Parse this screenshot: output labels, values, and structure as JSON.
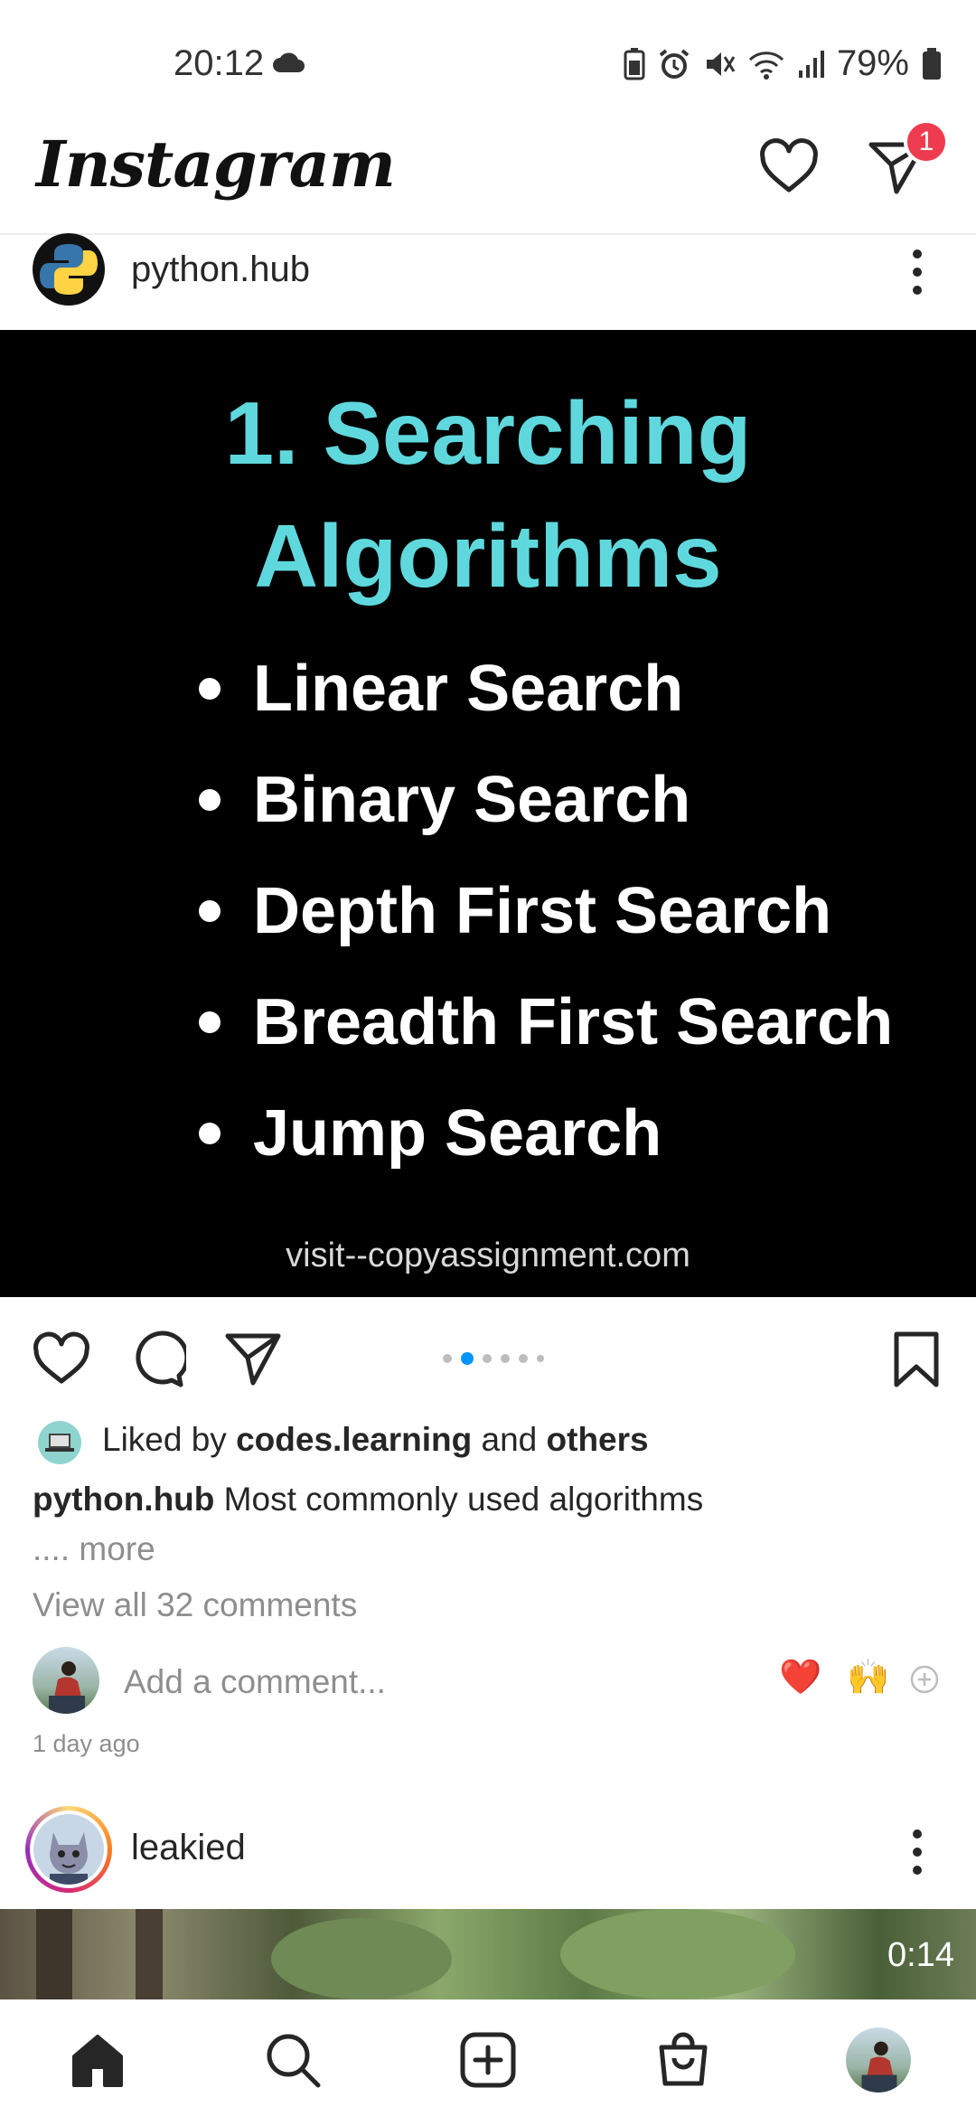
{
  "status_bar": {
    "time": "20:12",
    "battery": "79%"
  },
  "header": {
    "logo": "Instagram",
    "messages_badge": "1"
  },
  "post": {
    "username": "python.hub",
    "image": {
      "title_line1": "1. Searching",
      "title_line2": "Algorithms",
      "items": [
        "Linear Search",
        "Binary Search",
        "Depth First Search",
        "Breadth First Search",
        "Jump Search"
      ],
      "footer": "visit--copyassignment.com"
    },
    "carousel": {
      "count": 6,
      "active": 2
    },
    "liked_by_prefix": "Liked by",
    "liked_by_user": "codes.learning",
    "liked_by_and": "and",
    "liked_by_others": "others",
    "caption_user": "python.hub",
    "caption_text": "Most commonly used algorithms",
    "caption_more": ".... more",
    "view_comments": "View all 32 comments",
    "comment_placeholder": "Add a comment...",
    "quick_emoji_1": "❤️",
    "quick_emoji_2": "🙌",
    "time_ago": "1 day ago"
  },
  "next_post": {
    "username": "leakied",
    "video_duration": "0:14"
  },
  "colors": {
    "accent": "#0095f6",
    "badge": "#ef3b4f",
    "image_title": "#5fd8dd"
  }
}
